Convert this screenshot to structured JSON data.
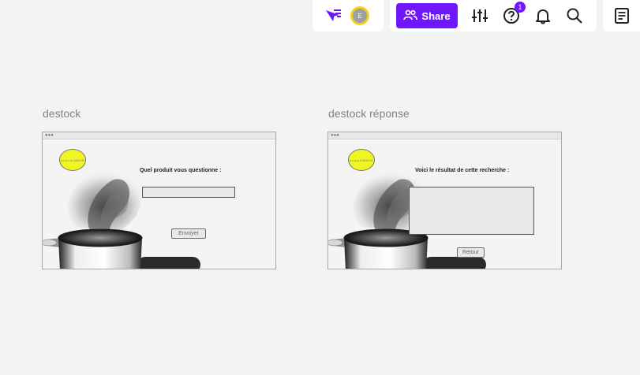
{
  "toolbar": {
    "share_label": "Share",
    "notifications_badge": "1",
    "avatar_initial": "E",
    "accent": "#6f16ff",
    "icons": [
      "filter-cursor-icon",
      "users-icon",
      "sliders-icon",
      "help-icon",
      "bell-icon",
      "search-icon",
      "notes-icon"
    ]
  },
  "frames": [
    {
      "title": "destock",
      "logo_text": "s-t-o-c-k DOLCE",
      "prompt": "Quel produit vous questionne :",
      "button_label": "Envoyer"
    },
    {
      "title": "destock réponse",
      "logo_text": "s-t-o-c-k DOLCE",
      "prompt": "Voici le résultat de cette recherche :",
      "button_label": "Retour"
    }
  ]
}
